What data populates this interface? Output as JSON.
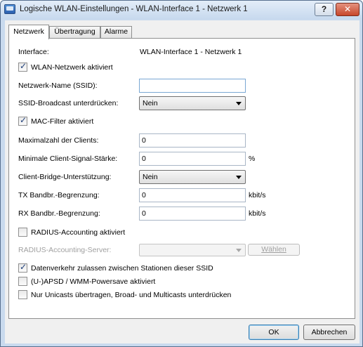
{
  "window": {
    "title": "Logische WLAN-Einstellungen - WLAN-Interface 1 - Netzwerk 1",
    "help_label": "?",
    "close_label": "✕"
  },
  "tabs": [
    "Netzwerk",
    "Übertragung",
    "Alarme"
  ],
  "form": {
    "interface_label": "Interface:",
    "interface_value": "WLAN-Interface 1 - Netzwerk 1",
    "wlan_enabled_label": "WLAN-Netzwerk aktiviert",
    "wlan_enabled_checked": true,
    "ssid_label": "Netzwerk-Name (SSID):",
    "ssid_value": "",
    "ssid_broadcast_label": "SSID-Broadcast unterdrücken:",
    "ssid_broadcast_value": "Nein",
    "mac_filter_label": "MAC-Filter aktiviert",
    "mac_filter_checked": true,
    "max_clients_label": "Maximalzahl der Clients:",
    "max_clients_value": "0",
    "min_signal_label": "Minimale Client-Signal-Stärke:",
    "min_signal_value": "0",
    "min_signal_unit": "%",
    "client_bridge_label": "Client-Bridge-Unterstützung:",
    "client_bridge_value": "Nein",
    "tx_limit_label": "TX Bandbr.-Begrenzung:",
    "tx_limit_value": "0",
    "tx_limit_unit": "kbit/s",
    "rx_limit_label": "RX Bandbr.-Begrenzung:",
    "rx_limit_value": "0",
    "rx_limit_unit": "kbit/s",
    "radius_accounting_label": "RADIUS-Accounting aktiviert",
    "radius_accounting_checked": false,
    "radius_server_label": "RADIUS-Accounting-Server:",
    "radius_server_value": "",
    "choose_label": "Wählen",
    "allow_traffic_label": "Datenverkehr zulassen zwischen Stationen dieser SSID",
    "allow_traffic_checked": true,
    "apsd_label": "(U-)APSD / WMM-Powersave aktiviert",
    "apsd_checked": false,
    "unicast_only_label": "Nur Unicasts übertragen, Broad- und Multicasts unterdrücken",
    "unicast_only_checked": false
  },
  "buttons": {
    "ok": "OK",
    "cancel": "Abbrechen"
  }
}
